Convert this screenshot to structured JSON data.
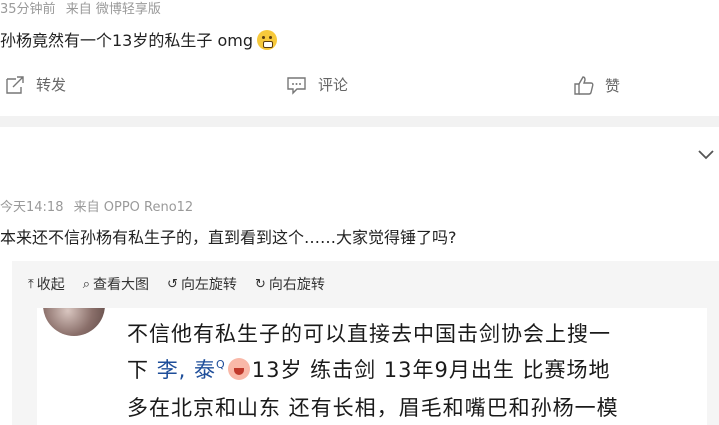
{
  "post1": {
    "time": "35分钟前",
    "source": "来自 微博轻享版",
    "text": "孙杨竟然有一个13岁的私生子 omg",
    "emoji": "face-with-hand-over-mouth"
  },
  "actions": {
    "repost": "转发",
    "comment": "评论",
    "like": "赞"
  },
  "post2": {
    "time": "今天14:18",
    "source": "来自 OPPO Reno12",
    "text": "本来还不信孙杨有私生子的，直到看到这个……大家觉得锤了吗?"
  },
  "image_toolbar": {
    "collapse": "收起",
    "view_large": "查看大图",
    "rotate_left": "向左旋转",
    "rotate_right": "向右旋转"
  },
  "image_text": {
    "line1": "不信他有私生子的可以直接去中国击剑协会上搜一",
    "line2_prefix": "下",
    "line2_name": "李,  泰",
    "line2_rest": "13岁 练击剑 13年9月出生 比赛场地",
    "line3": "多在北京和山东 还有长相，眉毛和嘴巴和孙杨一模"
  }
}
